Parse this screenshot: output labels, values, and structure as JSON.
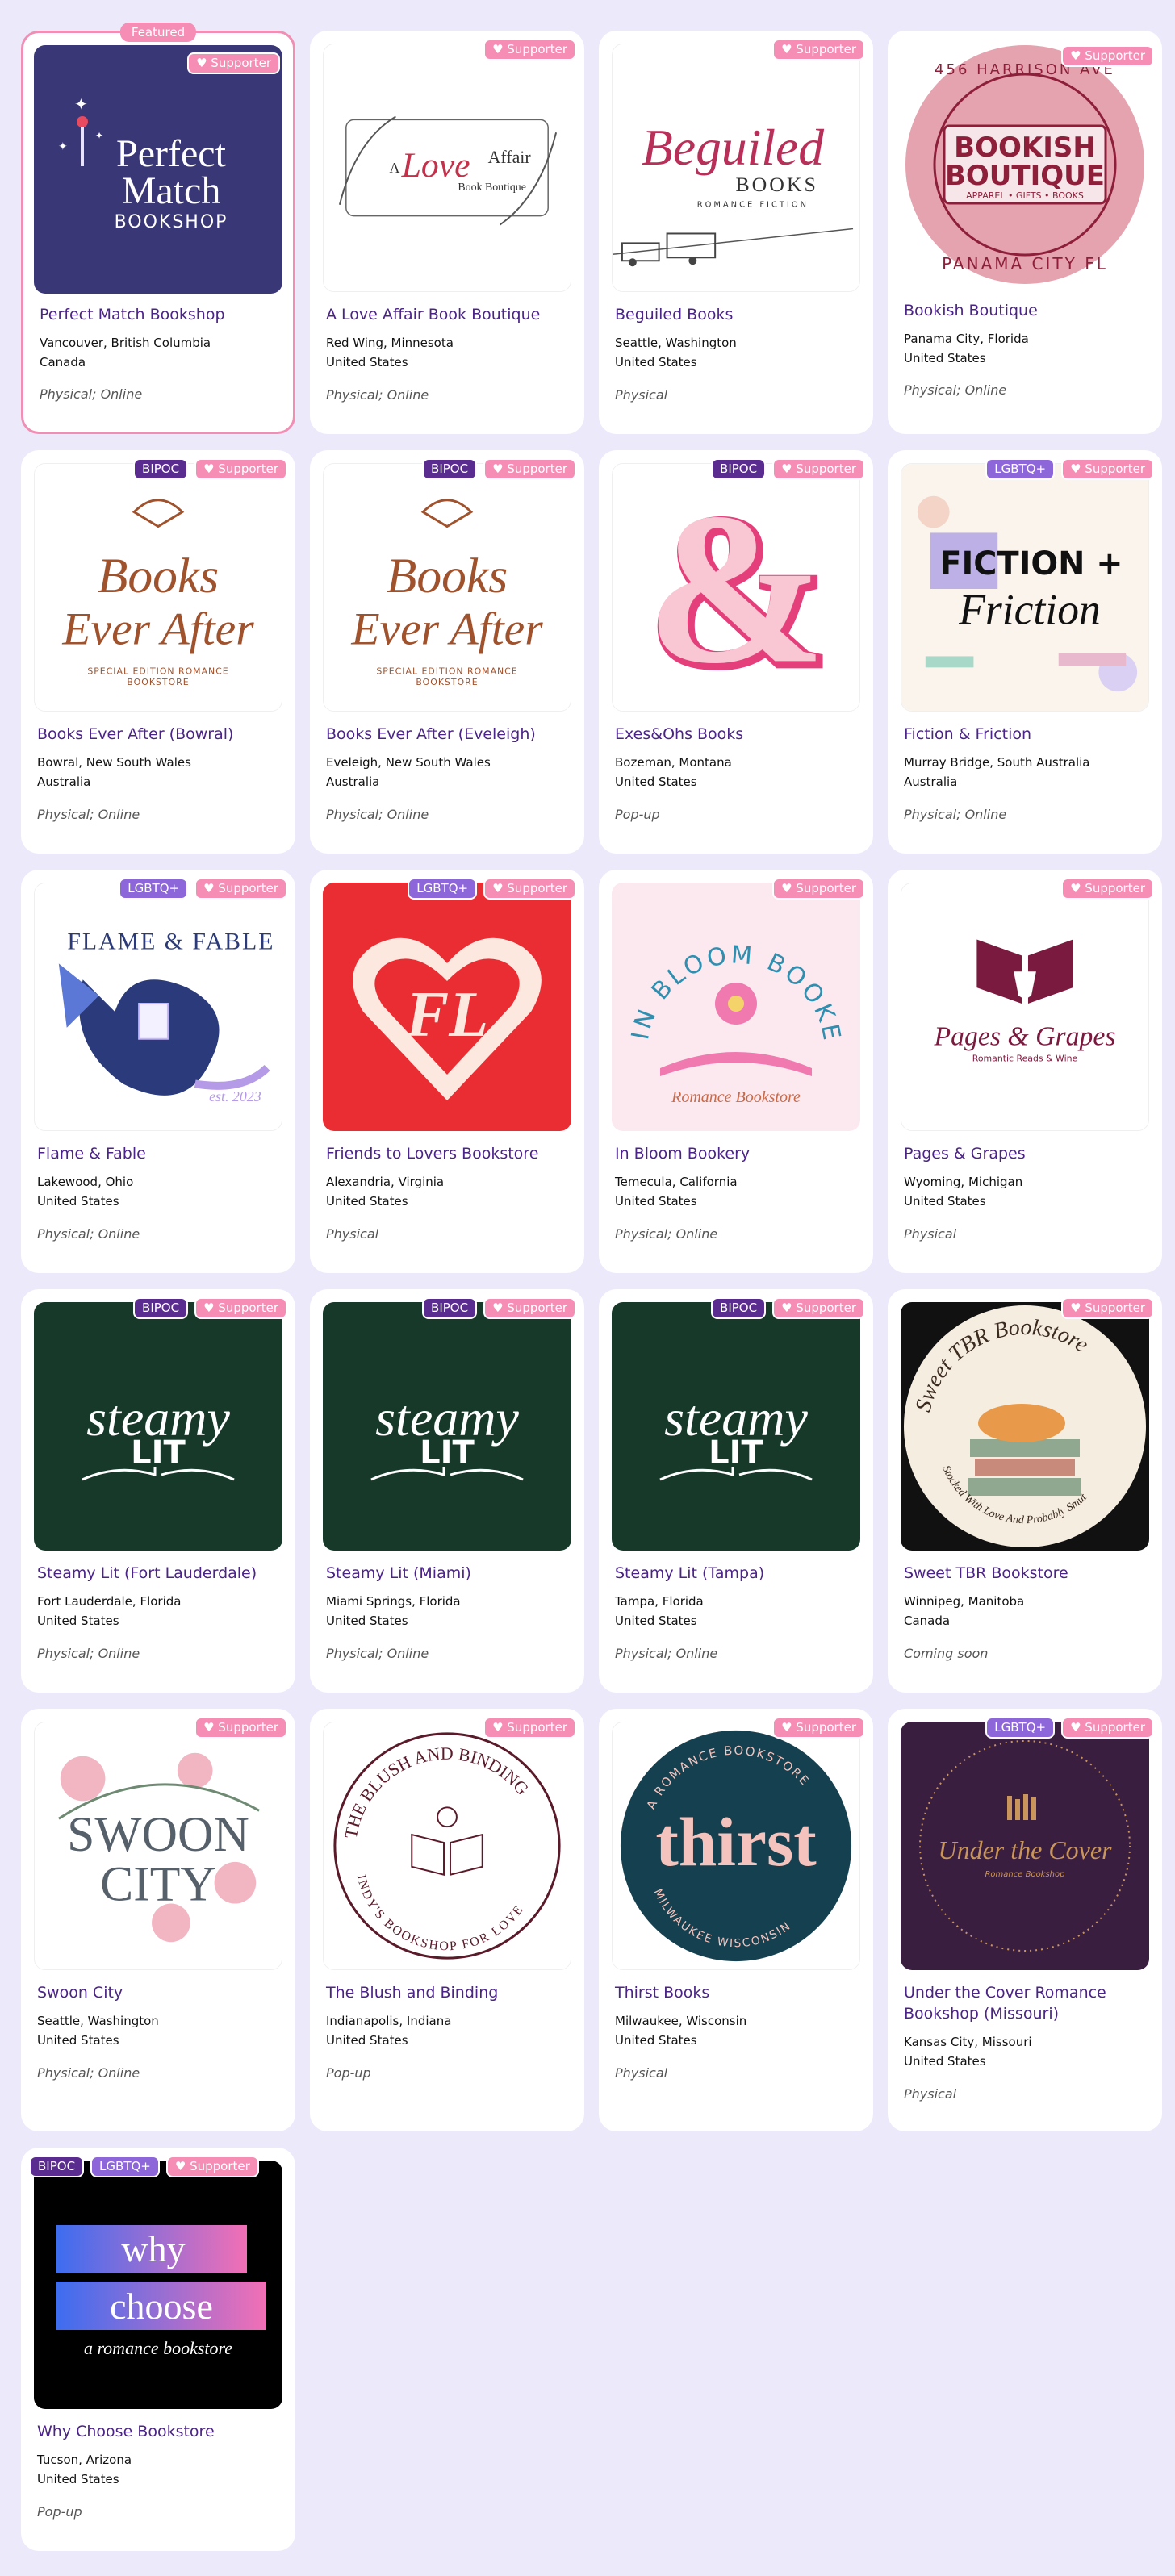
{
  "labels": {
    "featured": "Featured",
    "supporter": "♥ Supporter",
    "bipoc": "BIPOC",
    "lgbtq": "LGBTQ+"
  },
  "stores": [
    {
      "name": "Perfect Match Bookshop",
      "city": "Vancouver, British Columbia",
      "country": "Canada",
      "type": "Physical; Online",
      "badges": [
        "supporter"
      ],
      "logo_text": [
        "Perfect",
        "Match",
        "BOOKSHOP"
      ]
    },
    {
      "name": "A Love Affair Book Boutique",
      "city": "Red Wing, Minnesota",
      "country": "United States",
      "type": "Physical; Online",
      "badges": [
        "supporter"
      ],
      "logo_text": [
        "A",
        "Love",
        "Affair",
        "Book Boutique"
      ]
    },
    {
      "name": "Beguiled Books",
      "city": "Seattle, Washington",
      "country": "United States",
      "type": "Physical",
      "badges": [
        "supporter"
      ],
      "logo_text": [
        "Beguiled",
        "BOOKS",
        "ROMANCE FICTION"
      ]
    },
    {
      "name": "Bookish Boutique",
      "city": "Panama City, Florida",
      "country": "United States",
      "type": "Physical; Online",
      "badges": [
        "supporter"
      ],
      "logo_text": [
        "456 HARRISON AVE",
        "BOOKISH",
        "BOUTIQUE",
        "APPAREL • GIFTS • BOOKS",
        "PANAMA CITY FL"
      ]
    },
    {
      "name": "Books Ever After (Bowral)",
      "city": "Bowral, New South Wales",
      "country": "Australia",
      "type": "Physical; Online",
      "badges": [
        "bipoc",
        "supporter"
      ],
      "logo_text": [
        "Books",
        "Ever After",
        "SPECIAL EDITION ROMANCE",
        "BOOKSTORE"
      ]
    },
    {
      "name": "Books Ever After (Eveleigh)",
      "city": "Eveleigh, New South Wales",
      "country": "Australia",
      "type": "Physical; Online",
      "badges": [
        "bipoc",
        "supporter"
      ],
      "logo_text": [
        "Books",
        "Ever After",
        "SPECIAL EDITION ROMANCE",
        "BOOKSTORE"
      ]
    },
    {
      "name": "Exes&Ohs Books",
      "city": "Bozeman, Montana",
      "country": "United States",
      "type": "Pop-up",
      "badges": [
        "bipoc",
        "supporter"
      ],
      "logo_text": [
        "&"
      ]
    },
    {
      "name": "Fiction & Friction",
      "city": "Murray Bridge, South Australia",
      "country": "Australia",
      "type": "Physical; Online",
      "badges": [
        "lgbtq",
        "supporter"
      ],
      "logo_text": [
        "FICTION +",
        "Friction"
      ]
    },
    {
      "name": "Flame & Fable",
      "city": "Lakewood, Ohio",
      "country": "United States",
      "type": "Physical; Online",
      "badges": [
        "lgbtq",
        "supporter"
      ],
      "logo_text": [
        "FLAME & FABLE",
        "est. 2023"
      ]
    },
    {
      "name": "Friends to Lovers Bookstore",
      "city": "Alexandria, Virginia",
      "country": "United States",
      "type": "Physical",
      "badges": [
        "lgbtq",
        "supporter"
      ],
      "logo_text": [
        "FL"
      ]
    },
    {
      "name": "In Bloom Bookery",
      "city": "Temecula, California",
      "country": "United States",
      "type": "Physical; Online",
      "badges": [
        "supporter"
      ],
      "logo_text": [
        "IN BLOOM BOOKERY",
        "Romance Bookstore"
      ]
    },
    {
      "name": "Pages & Grapes",
      "city": "Wyoming, Michigan",
      "country": "United States",
      "type": "Physical",
      "badges": [
        "supporter"
      ],
      "logo_text": [
        "Pages & Grapes",
        "Romantic Reads & Wine"
      ]
    },
    {
      "name": "Steamy Lit (Fort Lauderdale)",
      "city": "Fort Lauderdale, Florida",
      "country": "United States",
      "type": "Physical; Online",
      "badges": [
        "bipoc",
        "supporter"
      ],
      "logo_text": [
        "steamy",
        "LIT"
      ]
    },
    {
      "name": "Steamy Lit (Miami)",
      "city": "Miami Springs, Florida",
      "country": "United States",
      "type": "Physical; Online",
      "badges": [
        "bipoc",
        "supporter"
      ],
      "logo_text": [
        "steamy",
        "LIT"
      ]
    },
    {
      "name": "Steamy Lit (Tampa)",
      "city": "Tampa, Florida",
      "country": "United States",
      "type": "Physical; Online",
      "badges": [
        "bipoc",
        "supporter"
      ],
      "logo_text": [
        "steamy",
        "LIT"
      ]
    },
    {
      "name": "Sweet TBR Bookstore",
      "city": "Winnipeg, Manitoba",
      "country": "Canada",
      "type": "Coming soon",
      "badges": [
        "supporter"
      ],
      "logo_text": [
        "Sweet TBR Bookstore",
        "Stocked With Love And Probably Smut"
      ]
    },
    {
      "name": "Swoon City",
      "city": "Seattle, Washington",
      "country": "United States",
      "type": "Physical; Online",
      "badges": [
        "supporter"
      ],
      "logo_text": [
        "SWOON",
        "CITY"
      ]
    },
    {
      "name": "The Blush and Binding",
      "city": "Indianapolis, Indiana",
      "country": "United States",
      "type": "Pop-up",
      "badges": [
        "supporter"
      ],
      "logo_text": [
        "THE BLUSH AND BINDING",
        "INDY'S BOOKSHOP FOR LOVE"
      ]
    },
    {
      "name": "Thirst Books",
      "city": "Milwaukee, Wisconsin",
      "country": "United States",
      "type": "Physical",
      "badges": [
        "supporter"
      ],
      "logo_text": [
        "A ROMANCE BOOKSTORE",
        "thirst",
        "MILWAUKEE WISCONSIN"
      ]
    },
    {
      "name": "Under the Cover Romance Bookshop (Missouri)",
      "city": "Kansas City, Missouri",
      "country": "United States",
      "type": "Physical",
      "badges": [
        "lgbtq",
        "supporter"
      ],
      "logo_text": [
        "Under the Cover",
        "Romance Bookshop"
      ]
    },
    {
      "name": "Why Choose Bookstore",
      "city": "Tucson, Arizona",
      "country": "United States",
      "type": "Pop-up",
      "badges": [
        "bipoc",
        "lgbtq",
        "supporter"
      ],
      "logo_text": [
        "why",
        "choose",
        "a romance bookstore"
      ]
    }
  ]
}
